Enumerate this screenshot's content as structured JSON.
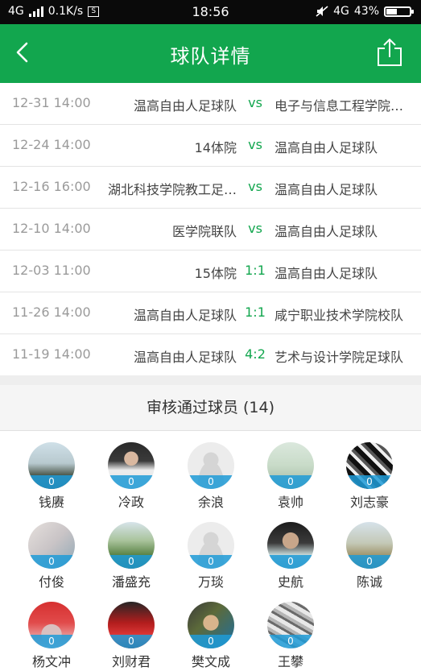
{
  "status_bar": {
    "network": "4G",
    "speed": "0.1K/s",
    "time": "18:56",
    "network_right": "4G",
    "battery": "43%",
    "battery_level": 0.43
  },
  "header": {
    "title": "球队详情",
    "back_icon": "chevron-left-icon",
    "share_icon": "share-icon"
  },
  "matches": [
    {
      "date": "12-31  14:00",
      "home": "温高自由人足球队",
      "mid": "vs",
      "away": "电子与信息工程学院…"
    },
    {
      "date": "12-24  14:00",
      "home": "14体院",
      "mid": "vs",
      "away": "温高自由人足球队"
    },
    {
      "date": "12-16  16:00",
      "home": "湖北科技学院教工足…",
      "mid": "vs",
      "away": "温高自由人足球队"
    },
    {
      "date": "12-10  14:00",
      "home": "医学院联队",
      "mid": "vs",
      "away": "温高自由人足球队"
    },
    {
      "date": "12-03  11:00",
      "home": "15体院",
      "mid": "1:1",
      "away": "温高自由人足球队"
    },
    {
      "date": "11-26  14:00",
      "home": "温高自由人足球队",
      "mid": "1:1",
      "away": "咸宁职业技术学院校队"
    },
    {
      "date": "11-19  14:00",
      "home": "温高自由人足球队",
      "mid": "4:2",
      "away": "艺术与设计学院足球队"
    }
  ],
  "players_section": {
    "title": "审核通过球员 (14)"
  },
  "players": [
    {
      "name": "钱赓",
      "count": "0"
    },
    {
      "name": "冷政",
      "count": "0"
    },
    {
      "name": "余浪",
      "count": "0"
    },
    {
      "name": "袁帅",
      "count": "0"
    },
    {
      "name": "刘志豪",
      "count": "0"
    },
    {
      "name": "付俊",
      "count": "0"
    },
    {
      "name": "潘盛充",
      "count": "0"
    },
    {
      "name": "万琰",
      "count": "0"
    },
    {
      "name": "史航",
      "count": "0"
    },
    {
      "name": "陈诚",
      "count": "0"
    },
    {
      "name": "杨文冲",
      "count": "0"
    },
    {
      "name": "刘财君",
      "count": "0"
    },
    {
      "name": "樊文成",
      "count": "0"
    },
    {
      "name": "王攀",
      "count": "0"
    }
  ]
}
